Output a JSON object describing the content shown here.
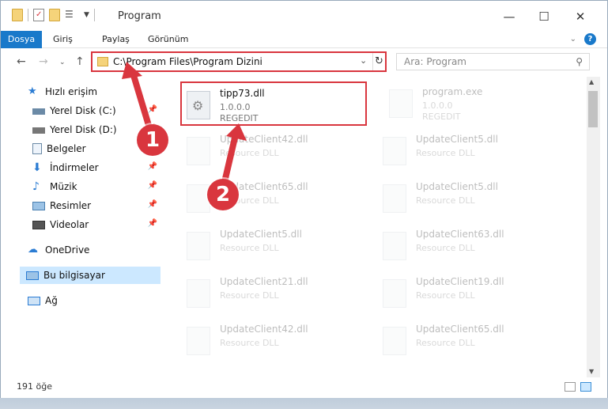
{
  "window": {
    "title": "Program",
    "controls": [
      "minimize-icon",
      "maximize-icon",
      "close-icon"
    ]
  },
  "ribbon": {
    "tabs": [
      {
        "label": "Dosya"
      },
      {
        "label": "Giriş"
      },
      {
        "label": "Paylaş"
      },
      {
        "label": "Görünüm"
      }
    ],
    "help": "?"
  },
  "address": {
    "path": "C:\\Program Files\\Program Dizini"
  },
  "search": {
    "placeholder": "Ara: Program"
  },
  "sidebar": {
    "items": [
      {
        "label": "Hızlı erişim",
        "icon": "star-icon",
        "pinned": false
      },
      {
        "label": "Yerel Disk (C:)",
        "icon": "drive-icon",
        "pinned": true
      },
      {
        "label": "Yerel Disk (D:)",
        "icon": "drive-icon",
        "pinned": true
      },
      {
        "label": "Belgeler",
        "icon": "documents-icon",
        "pinned": true
      },
      {
        "label": "İndirmeler",
        "icon": "download-icon",
        "pinned": true
      },
      {
        "label": "Müzik",
        "icon": "music-icon",
        "pinned": true
      },
      {
        "label": "Resimler",
        "icon": "pictures-icon",
        "pinned": true
      },
      {
        "label": "Videolar",
        "icon": "video-icon",
        "pinned": true
      },
      {
        "label": "OneDrive",
        "icon": "cloud-icon",
        "pinned": false
      },
      {
        "label": "Bu bilgisayar",
        "icon": "computer-icon",
        "pinned": false
      },
      {
        "label": "Ağ",
        "icon": "network-icon",
        "pinned": false
      }
    ]
  },
  "files": [
    {
      "name": "tipp73.dll",
      "line1": "1.0.0.0",
      "line2": "REGEDIT"
    },
    {
      "name": "program.exe",
      "line1": "1.0.0.0",
      "line2": "REGEDIT"
    },
    {
      "name": "UpdateClient42.dll",
      "line1": "Resource DLL",
      "line2": ""
    },
    {
      "name": "UpdateClient5.dll",
      "line1": "Resource DLL",
      "line2": ""
    },
    {
      "name": "UpdateClient65.dll",
      "line1": "Resource DLL",
      "line2": ""
    },
    {
      "name": "UpdateClient5.dll",
      "line1": "Resource DLL",
      "line2": ""
    },
    {
      "name": "UpdateClient5.dll",
      "line1": "Resource DLL",
      "line2": ""
    },
    {
      "name": "UpdateClient63.dll",
      "line1": "Resource DLL",
      "line2": ""
    },
    {
      "name": "UpdateClient21.dll",
      "line1": "Resource DLL",
      "line2": ""
    },
    {
      "name": "UpdateClient19.dll",
      "line1": "Resource DLL",
      "line2": ""
    },
    {
      "name": "UpdateClient42.dll",
      "line1": "Resource DLL",
      "line2": ""
    },
    {
      "name": "UpdateClient65.dll",
      "line1": "Resource DLL",
      "line2": ""
    }
  ],
  "status": {
    "count": "191 öğe"
  },
  "annotations": {
    "step1": "1",
    "step2": "2",
    "color": "#d9363e"
  }
}
